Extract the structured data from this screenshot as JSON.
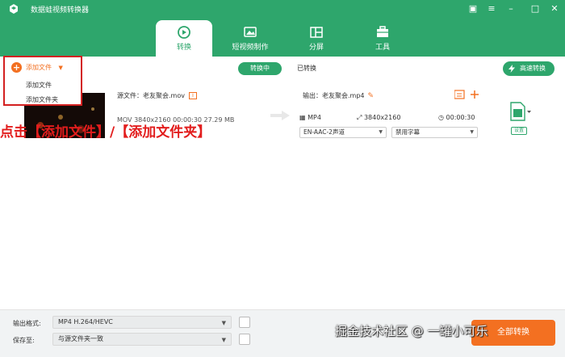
{
  "app": {
    "title": "数据蛙视频转换器",
    "accent": "#2ea66c",
    "orange": "#f37021"
  },
  "window_controls": [
    "message-icon",
    "menu-icon",
    "minimize-icon",
    "maximize-icon",
    "close-icon"
  ],
  "nav": {
    "tabs": [
      {
        "label": "转换",
        "icon": "convert-icon",
        "active": true
      },
      {
        "label": "短视频制作",
        "icon": "image-icon",
        "active": false
      },
      {
        "label": "分屏",
        "icon": "split-screen-icon",
        "active": false
      },
      {
        "label": "工具",
        "icon": "toolbox-icon",
        "active": false
      }
    ]
  },
  "subtabs": {
    "converting": "转换中",
    "converted": "已转换"
  },
  "fast_convert": "高速转换",
  "add_file": {
    "label": "添加文件",
    "menu": [
      "添加文件",
      "添加文件夹"
    ]
  },
  "file": {
    "source_label": "源文件：老友聚会.mov",
    "source_meta": "MOV  3840x2160  00:00:30  27.29 MB",
    "output_label": "输出：老友聚会.mp4",
    "out_format": "MP4",
    "out_resolution": "3840x2160",
    "out_duration": "00:00:30",
    "audio_track": "EN-AAC-2声道",
    "subtitle": "禁用字幕",
    "setting_label": "设置"
  },
  "annotation": "点击【添加文件】/【添加文件夹】",
  "bottom": {
    "format_label": "输出格式:",
    "format_value": "MP4 H.264/HEVC",
    "save_label": "保存至:",
    "save_value": "与源文件夹一致",
    "convert_all": "全部转换"
  },
  "watermark": "掘金技术社区 @ 一罐小可乐"
}
